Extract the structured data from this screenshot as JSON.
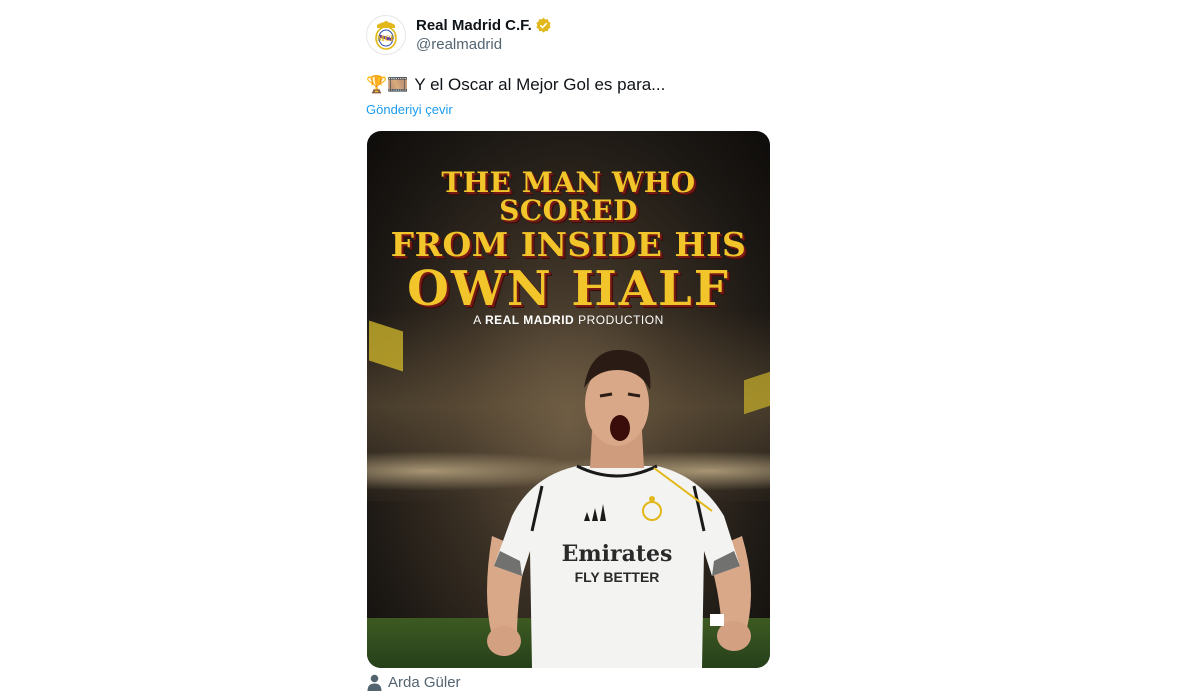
{
  "tweet": {
    "author": {
      "display_name": "Real Madrid C.F.",
      "handle": "@realmadrid",
      "verified_color": "#e2b719"
    },
    "text_emojis": "🏆🎞️",
    "text": "Y el Oscar al Mejor Gol es para...",
    "translate_label": "Gönderiyi çevir",
    "media": {
      "title_line1": "THE MAN WHO SCORED",
      "title_line2": "FROM INSIDE HIS",
      "title_line3": "OWN HALF",
      "subtitle_prefix": "A",
      "subtitle_brand": "REAL MADRID",
      "subtitle_suffix": "PRODUCTION",
      "sponsor_line1": "Emirates",
      "sponsor_line2": "FLY BETTER"
    },
    "tagged_person": "Arda Güler"
  },
  "colors": {
    "link": "#1d9bf0",
    "secondary_text": "#536471",
    "poster_title": "#f2c62a"
  }
}
